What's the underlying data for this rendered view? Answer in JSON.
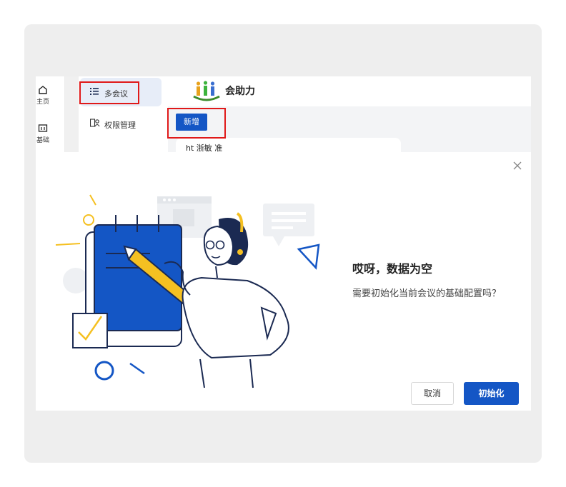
{
  "rail": {
    "items": [
      {
        "label": "主页",
        "icon": "home-icon"
      },
      {
        "label": "基础",
        "icon": "dashboard-icon"
      }
    ]
  },
  "sidebar": {
    "items": [
      {
        "label": "多会议",
        "icon": "list-icon",
        "active": true
      },
      {
        "label": "权限管理",
        "icon": "permission-icon",
        "active": false
      }
    ]
  },
  "header": {
    "logo_text": "会助力"
  },
  "toolbar": {
    "add_label": "新增"
  },
  "card": {
    "text": "ht 浙敏 准"
  },
  "dialog": {
    "title": "哎呀，数据为空",
    "description": "需要初始化当前会议的基础配置吗？",
    "cancel_label": "取消",
    "init_label": "初始化"
  },
  "colors": {
    "primary": "#1456c5",
    "highlight": "#e01919",
    "accent_yellow": "#f5c021"
  }
}
